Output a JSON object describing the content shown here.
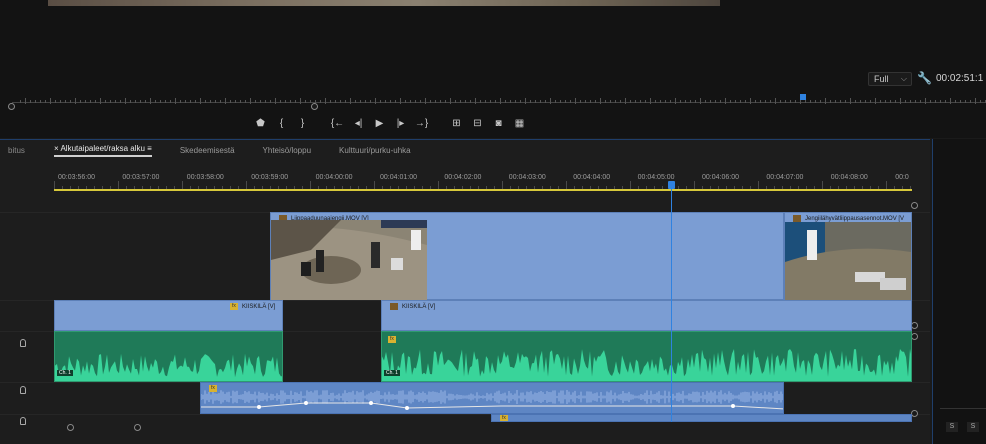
{
  "monitor": {
    "zoom_value": "Full",
    "zoom_options_icon": "chevron-down-icon",
    "timecode": "00:02:51:1",
    "settings_icon": "wrench-icon"
  },
  "transport_buttons": [
    {
      "name": "add-marker-button",
      "glyph": "⬟"
    },
    {
      "name": "mark-in-button",
      "glyph": "{"
    },
    {
      "name": "mark-out-button",
      "glyph": "}"
    },
    {
      "name": "go-to-in-button",
      "glyph": "{←"
    },
    {
      "name": "step-back-button",
      "glyph": "◂|"
    },
    {
      "name": "play-button",
      "glyph": "▶"
    },
    {
      "name": "step-forward-button",
      "glyph": "|▸"
    },
    {
      "name": "go-to-out-button",
      "glyph": "→}"
    },
    {
      "name": "lift-button",
      "glyph": "⊞"
    },
    {
      "name": "extract-button",
      "glyph": "⊟"
    },
    {
      "name": "export-frame-button",
      "glyph": "◙"
    },
    {
      "name": "comparison-view-button",
      "glyph": "▦"
    }
  ],
  "timeline": {
    "left_tab_fragment": "bitus",
    "tabs": [
      {
        "label": "Alkutaipaleet/raksa alku",
        "active": true
      },
      {
        "label": "Skedeemisestä",
        "active": false
      },
      {
        "label": "Yhteisö/loppu",
        "active": false
      },
      {
        "label": "Kulttuuri/purku-uhka",
        "active": false
      }
    ],
    "tab_close": "×",
    "tab_menu": "≡",
    "ruler_times": [
      "00:03:56:00",
      "00:03:57:00",
      "00:03:58:00",
      "00:03:59:00",
      "00:04:00:00",
      "00:04:01:00",
      "00:04:02:00",
      "00:04:03:00",
      "00:04:04:00",
      "00:04:05:00",
      "00:04:06:00",
      "00:04:07:00",
      "00:04:08:00",
      "00:0"
    ]
  },
  "clips": {
    "v2_a": "Liippaaduunaajengii.MOV [V]",
    "v2_b": "Jengiilähyvätliippausasennot.MOV [V",
    "v1_a": "KIISKILÄ [V]",
    "v1_b": "KIISKILÄ [V]",
    "a1_a_ch": "Ch. 1",
    "a1_b_ch": "Ch. 1",
    "fx": "fx"
  },
  "right_panel": {
    "s1": "S",
    "s2": "S"
  }
}
